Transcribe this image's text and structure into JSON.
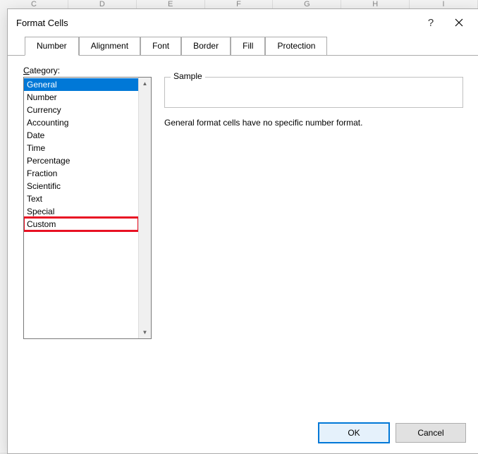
{
  "sheet_columns": [
    "C",
    "D",
    "E",
    "F",
    "G",
    "H",
    "I"
  ],
  "dialog": {
    "title": "Format Cells",
    "help_symbol": "?",
    "tabs": [
      {
        "label": "Number",
        "active": true
      },
      {
        "label": "Alignment",
        "active": false
      },
      {
        "label": "Font",
        "active": false
      },
      {
        "label": "Border",
        "active": false
      },
      {
        "label": "Fill",
        "active": false
      },
      {
        "label": "Protection",
        "active": false
      }
    ],
    "category_label_prefix": "",
    "category_label_underlined": "C",
    "category_label_rest": "ategory:",
    "categories": [
      {
        "label": "General",
        "selected": true,
        "highlight": false
      },
      {
        "label": "Number",
        "selected": false,
        "highlight": false
      },
      {
        "label": "Currency",
        "selected": false,
        "highlight": false
      },
      {
        "label": "Accounting",
        "selected": false,
        "highlight": false
      },
      {
        "label": "Date",
        "selected": false,
        "highlight": false
      },
      {
        "label": "Time",
        "selected": false,
        "highlight": false
      },
      {
        "label": "Percentage",
        "selected": false,
        "highlight": false
      },
      {
        "label": "Fraction",
        "selected": false,
        "highlight": false
      },
      {
        "label": "Scientific",
        "selected": false,
        "highlight": false
      },
      {
        "label": "Text",
        "selected": false,
        "highlight": false
      },
      {
        "label": "Special",
        "selected": false,
        "highlight": false
      },
      {
        "label": "Custom",
        "selected": false,
        "highlight": true
      }
    ],
    "sample_label": "Sample",
    "sample_value": "",
    "description": "General format cells have no specific number format.",
    "ok_label": "OK",
    "cancel_label": "Cancel"
  }
}
